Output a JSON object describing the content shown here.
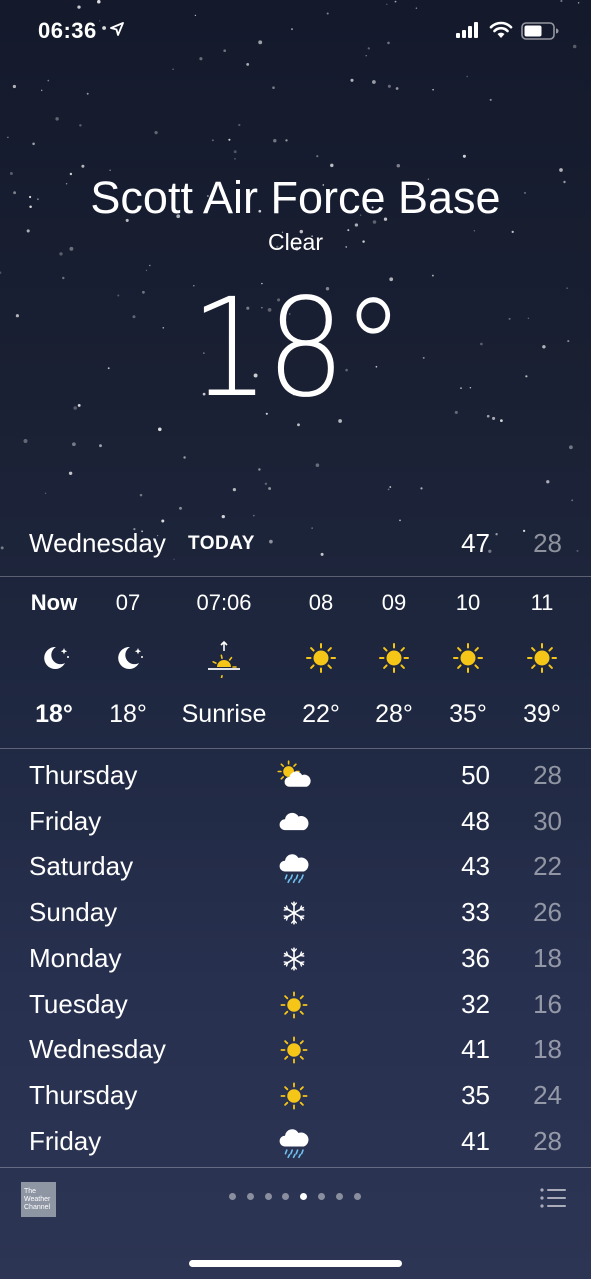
{
  "status_bar": {
    "time": "06:36",
    "icons": [
      "location-arrow-icon",
      "signal-icon",
      "wifi-icon",
      "battery-icon"
    ]
  },
  "location": {
    "city": "Scott Air Force Base",
    "condition": "Clear",
    "temperature": "18°"
  },
  "today": {
    "day": "Wednesday",
    "label": "TODAY",
    "high": "47",
    "low": "28"
  },
  "hourly": [
    {
      "time": "Now",
      "icon": "moon-stars-icon",
      "temp": "18°",
      "bold": true
    },
    {
      "time": "07",
      "icon": "moon-stars-icon",
      "temp": "18°",
      "bold": false
    },
    {
      "time": "07:06",
      "icon": "sunrise-icon",
      "temp": "Sunrise",
      "bold": false
    },
    {
      "time": "08",
      "icon": "sun-icon",
      "temp": "22°",
      "bold": false
    },
    {
      "time": "09",
      "icon": "sun-icon",
      "temp": "28°",
      "bold": false
    },
    {
      "time": "10",
      "icon": "sun-icon",
      "temp": "35°",
      "bold": false
    },
    {
      "time": "11",
      "icon": "sun-icon",
      "temp": "39°",
      "bold": false
    }
  ],
  "daily": [
    {
      "day": "Thursday",
      "icon": "partly-cloudy-icon",
      "high": "50",
      "low": "28"
    },
    {
      "day": "Friday",
      "icon": "cloud-icon",
      "high": "48",
      "low": "30"
    },
    {
      "day": "Saturday",
      "icon": "rain-cloud-icon",
      "high": "43",
      "low": "22"
    },
    {
      "day": "Sunday",
      "icon": "snowflake-icon",
      "high": "33",
      "low": "26"
    },
    {
      "day": "Monday",
      "icon": "snowflake-icon",
      "high": "36",
      "low": "18"
    },
    {
      "day": "Tuesday",
      "icon": "sun-icon",
      "high": "32",
      "low": "16"
    },
    {
      "day": "Wednesday",
      "icon": "sun-icon",
      "high": "41",
      "low": "18"
    },
    {
      "day": "Thursday",
      "icon": "sun-icon",
      "high": "35",
      "low": "24"
    },
    {
      "day": "Friday",
      "icon": "rain-cloud-icon",
      "high": "41",
      "low": "28"
    }
  ],
  "bottom_bar": {
    "logo_text": "The Weather Channel",
    "page_count": 8,
    "active_page": 5,
    "list_icon": "list-icon"
  },
  "colors": {
    "sun": "#f5c518",
    "rain": "#6ec1f0"
  }
}
